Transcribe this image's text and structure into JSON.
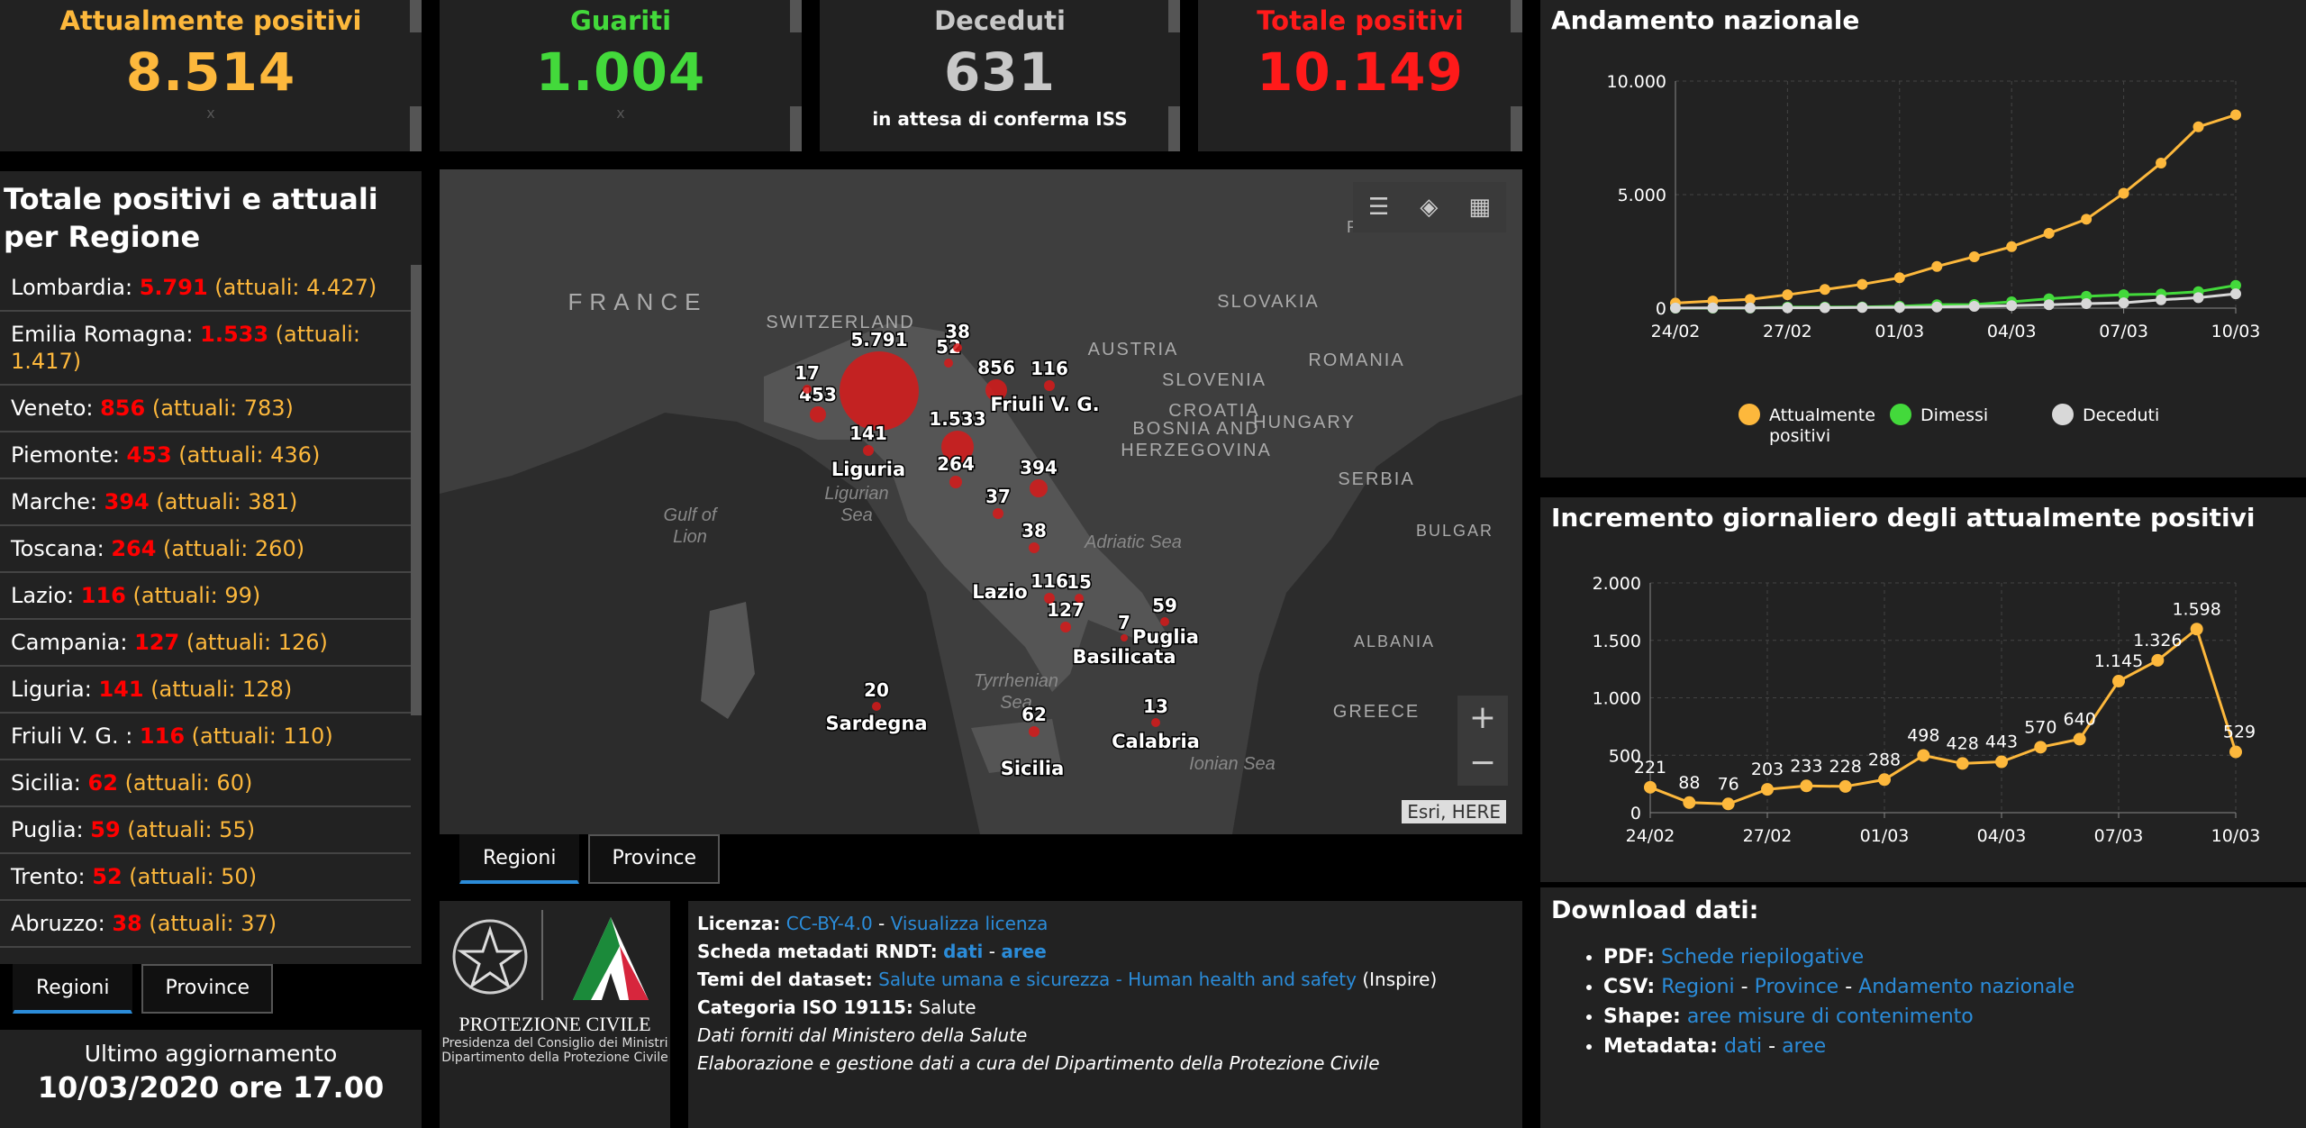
{
  "stats": {
    "attuali": {
      "title": "Attualmente positivi",
      "value": "8.514",
      "sub": "x",
      "color": "#fdb83c"
    },
    "guariti": {
      "title": "Guariti",
      "value": "1.004",
      "sub": "x",
      "color": "#43d93b"
    },
    "deceduti": {
      "title": "Deceduti",
      "value": "631",
      "sub": "in attesa di conferma ISS",
      "color": "#c8c8c8"
    },
    "totale": {
      "title": "Totale positivi",
      "value": "10.149",
      "color": "#ff1a1a"
    }
  },
  "regions_panel": {
    "title": "Totale positivi e attuali per Regione",
    "items": [
      {
        "name": "Lombardia:",
        "total": "5.791",
        "actual": "(attuali: 4.427)"
      },
      {
        "name": "Emilia Romagna:",
        "total": "1.533",
        "actual": "(attuali: 1.417)"
      },
      {
        "name": "Veneto:",
        "total": "856",
        "actual": "(attuali: 783)"
      },
      {
        "name": "Piemonte:",
        "total": "453",
        "actual": "(attuali: 436)"
      },
      {
        "name": "Marche:",
        "total": "394",
        "actual": "(attuali: 381)"
      },
      {
        "name": "Toscana:",
        "total": "264",
        "actual": "(attuali: 260)"
      },
      {
        "name": "Lazio:",
        "total": "116",
        "actual": "(attuali: 99)"
      },
      {
        "name": "Campania:",
        "total": "127",
        "actual": "(attuali: 126)"
      },
      {
        "name": "Liguria:",
        "total": "141",
        "actual": "(attuali: 128)"
      },
      {
        "name": "Friuli V. G. :",
        "total": "116",
        "actual": "(attuali: 110)"
      },
      {
        "name": "Sicilia:",
        "total": "62",
        "actual": "(attuali: 60)"
      },
      {
        "name": "Puglia:",
        "total": "59",
        "actual": "(attuali: 55)"
      },
      {
        "name": "Trento:",
        "total": "52",
        "actual": "(attuali: 50)"
      },
      {
        "name": "Abruzzo:",
        "total": "38",
        "actual": "(attuali: 37)"
      }
    ]
  },
  "list_tabs": {
    "regioni": "Regioni",
    "province": "Province"
  },
  "map_tabs": {
    "regioni": "Regioni",
    "province": "Province"
  },
  "updated": {
    "label": "Ultimo aggiornamento",
    "value": "10/03/2020 ore 17.00"
  },
  "map": {
    "attribution": "Esri, HERE",
    "zoom_in": "+",
    "zoom_out": "−",
    "countries": [
      "FRANCE",
      "SWITZERLAND",
      "AUSTRIA",
      "HUNGARY",
      "SLOVAKIA",
      "REPUBLIC",
      "SLOVENIA",
      "CROATIA",
      "ROMANIA",
      "BOSNIA AND",
      "HERZEGOVINA",
      "SERBIA",
      "BULGAR",
      "ALBANIA",
      "GREECE"
    ],
    "seas": [
      "Ligurian",
      "Sea",
      "Gulf of",
      "Lion",
      "Adriatic Sea",
      "Tyrrhenian",
      "Sea",
      "Ionian Sea"
    ],
    "bubble_labels": [
      "5.791",
      "1.533",
      "856",
      "453",
      "394",
      "264",
      "141",
      "127",
      "116",
      "116",
      "62",
      "59",
      "52",
      "38",
      "38",
      "37",
      "20",
      "17",
      "15",
      "13",
      "7"
    ],
    "place_labels": [
      "Friuli V. G.",
      "Liguria",
      "Lazio",
      "Puglia",
      "Basilicata",
      "Sardegna",
      "Calabria",
      "Sicilia"
    ]
  },
  "logo": {
    "line1": "PROTEZIONE CIVILE",
    "line2": "Presidenza del Consiglio dei Ministri",
    "line3": "Dipartimento della Protezione Civile"
  },
  "info": {
    "licenza_label": "Licenza:",
    "licenza_link": "CC-BY-4.0",
    "licenza_sep": " - ",
    "licenza_view": "Visualizza licenza",
    "rndt_label": "Scheda metadati RNDT:",
    "rndt_dati": "dati",
    "rndt_sep": " - ",
    "rndt_aree": "aree",
    "temi_label": "Temi del dataset:",
    "temi_link": "Salute umana e sicurezza - Human health and safety",
    "temi_suffix": " (Inspire)",
    "iso_label": "Categoria ISO 19115:",
    "iso_value": " Salute",
    "line5": "Dati forniti dal Ministero della Salute",
    "line6": "Elaborazione e gestione dati a cura del Dipartimento della Protezione Civile"
  },
  "trend": {
    "title": "Andamento nazionale"
  },
  "daily": {
    "title": "Incremento giornaliero degli attualmente positivi"
  },
  "chart_data": [
    {
      "type": "line",
      "title": "Andamento nazionale",
      "x": [
        "24/02",
        "25/02",
        "26/02",
        "27/02",
        "28/02",
        "29/02",
        "01/03",
        "02/03",
        "03/03",
        "04/03",
        "05/03",
        "06/03",
        "07/03",
        "08/03",
        "09/03",
        "10/03"
      ],
      "xticks": [
        "24/02",
        "27/02",
        "01/03",
        "04/03",
        "07/03",
        "10/03"
      ],
      "ylim": [
        0,
        10000
      ],
      "yticks": [
        "0",
        "5.000",
        "10.000"
      ],
      "yticks_values": [
        0,
        5000,
        10000
      ],
      "series": [
        {
          "name": "Attualmente positivi",
          "color": "#fdb83c",
          "values": [
            221,
            311,
            385,
            588,
            821,
            1049,
            1337,
            1835,
            2263,
            2706,
            3296,
            3916,
            5061,
            6387,
            7985,
            8514
          ]
        },
        {
          "name": "Dimessi",
          "color": "#43d93b",
          "values": [
            1,
            1,
            3,
            45,
            46,
            50,
            83,
            149,
            160,
            276,
            414,
            523,
            589,
            622,
            724,
            1004
          ]
        },
        {
          "name": "Deceduti",
          "color": "#d8d8d8",
          "values": [
            7,
            10,
            12,
            17,
            21,
            29,
            34,
            52,
            79,
            107,
            148,
            197,
            233,
            366,
            463,
            631
          ]
        }
      ],
      "legend": "bottom"
    },
    {
      "type": "line",
      "title": "Incremento giornaliero degli attualmente positivi",
      "x": [
        "24/02",
        "25/02",
        "26/02",
        "27/02",
        "28/02",
        "29/02",
        "01/03",
        "02/03",
        "03/03",
        "04/03",
        "05/03",
        "06/03",
        "07/03",
        "08/03",
        "09/03",
        "10/03"
      ],
      "xticks": [
        "24/02",
        "27/02",
        "01/03",
        "04/03",
        "07/03",
        "10/03"
      ],
      "ylim": [
        0,
        2000
      ],
      "yticks": [
        "0",
        "500",
        "1.000",
        "1.500",
        "2.000"
      ],
      "yticks_values": [
        0,
        500,
        1000,
        1500,
        2000
      ],
      "series": [
        {
          "color": "#fdb83c",
          "values": [
            221,
            88,
            76,
            203,
            233,
            228,
            288,
            498,
            428,
            443,
            570,
            640,
            1145,
            1326,
            1598,
            529
          ],
          "labels": [
            "221",
            "88",
            "76",
            "203",
            "233",
            "228",
            "288",
            "498",
            "428",
            "443",
            "570",
            "640",
            "1.145",
            "1.326",
            "1.598",
            "529"
          ]
        }
      ]
    }
  ],
  "download": {
    "title": "Download dati:",
    "pdf_label": "PDF:",
    "pdf_link": "Schede riepilogative",
    "csv_label": "CSV:",
    "csv_regioni": "Regioni",
    "csv_province": "Province",
    "csv_andamento": "Andamento nazionale",
    "sep": " - ",
    "shape_label": "Shape:",
    "shape_link": "aree misure di contenimento",
    "meta_label": "Metadata:",
    "meta_dati": "dati",
    "meta_aree": "aree"
  }
}
